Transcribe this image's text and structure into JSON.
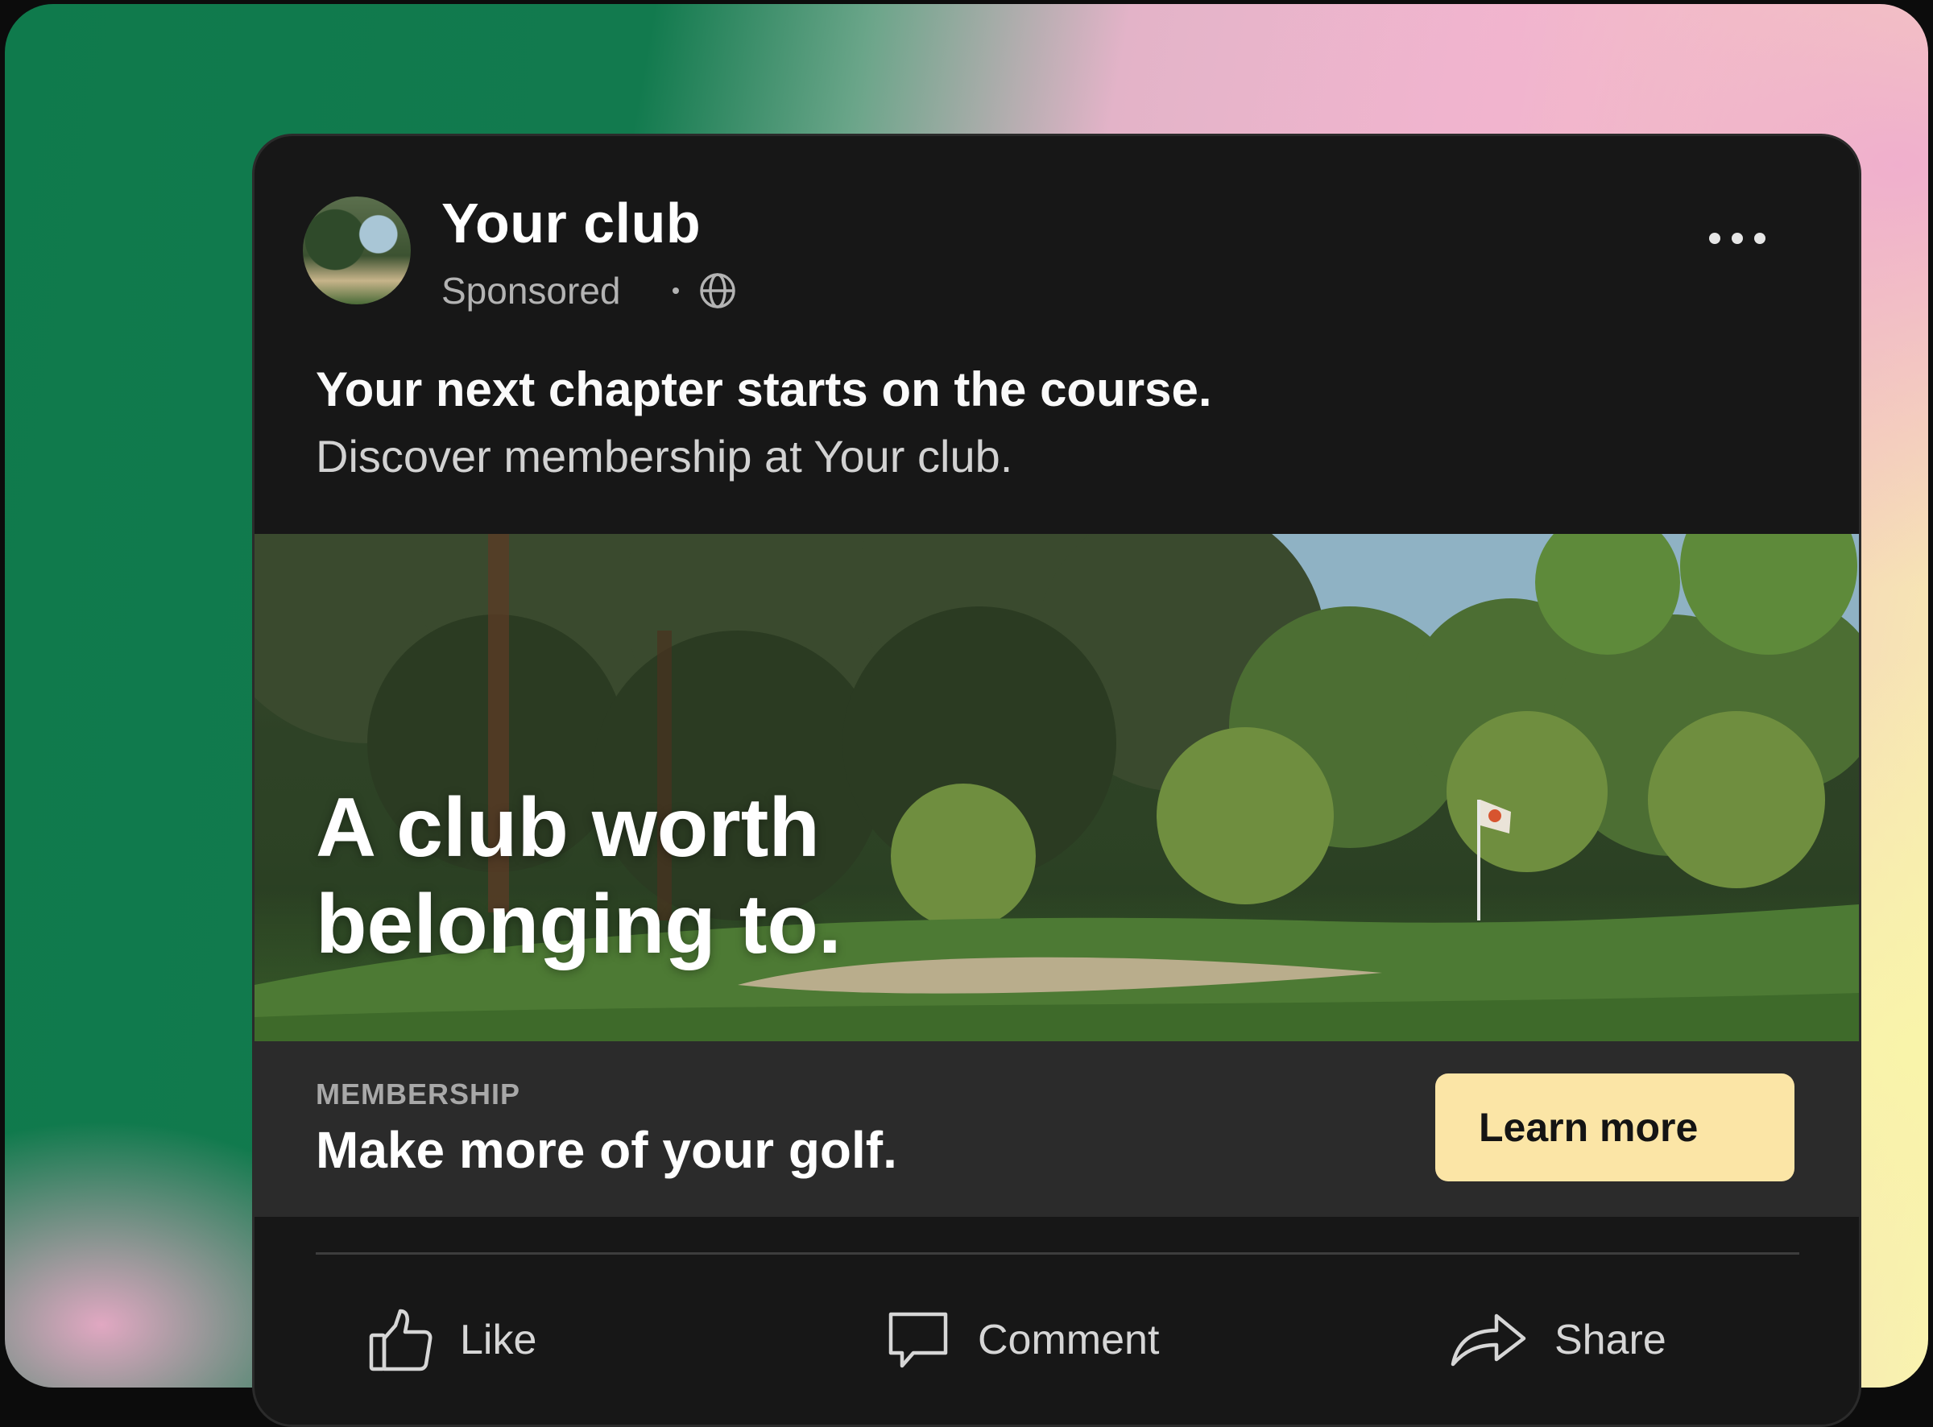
{
  "post": {
    "author": "Your club",
    "sponsored_label": "Sponsored",
    "headline": "Your next chapter starts on the course.",
    "subline": "Discover membership at Your club."
  },
  "hero": {
    "line1": "A club worth",
    "line2": "belonging to."
  },
  "promo": {
    "eyebrow": "MEMBERSHIP",
    "tagline": "Make more of your golf.",
    "cta_label": "Learn more"
  },
  "actions": {
    "like": "Like",
    "comment": "Comment",
    "share": "Share"
  },
  "colors": {
    "card": "#171717",
    "promo_bar": "#2b2b2b",
    "cta": "#fbe5a6"
  },
  "icons": [
    "globe-icon",
    "more-options-icon",
    "thumbs-up-icon",
    "comment-icon",
    "share-arrow-icon"
  ]
}
